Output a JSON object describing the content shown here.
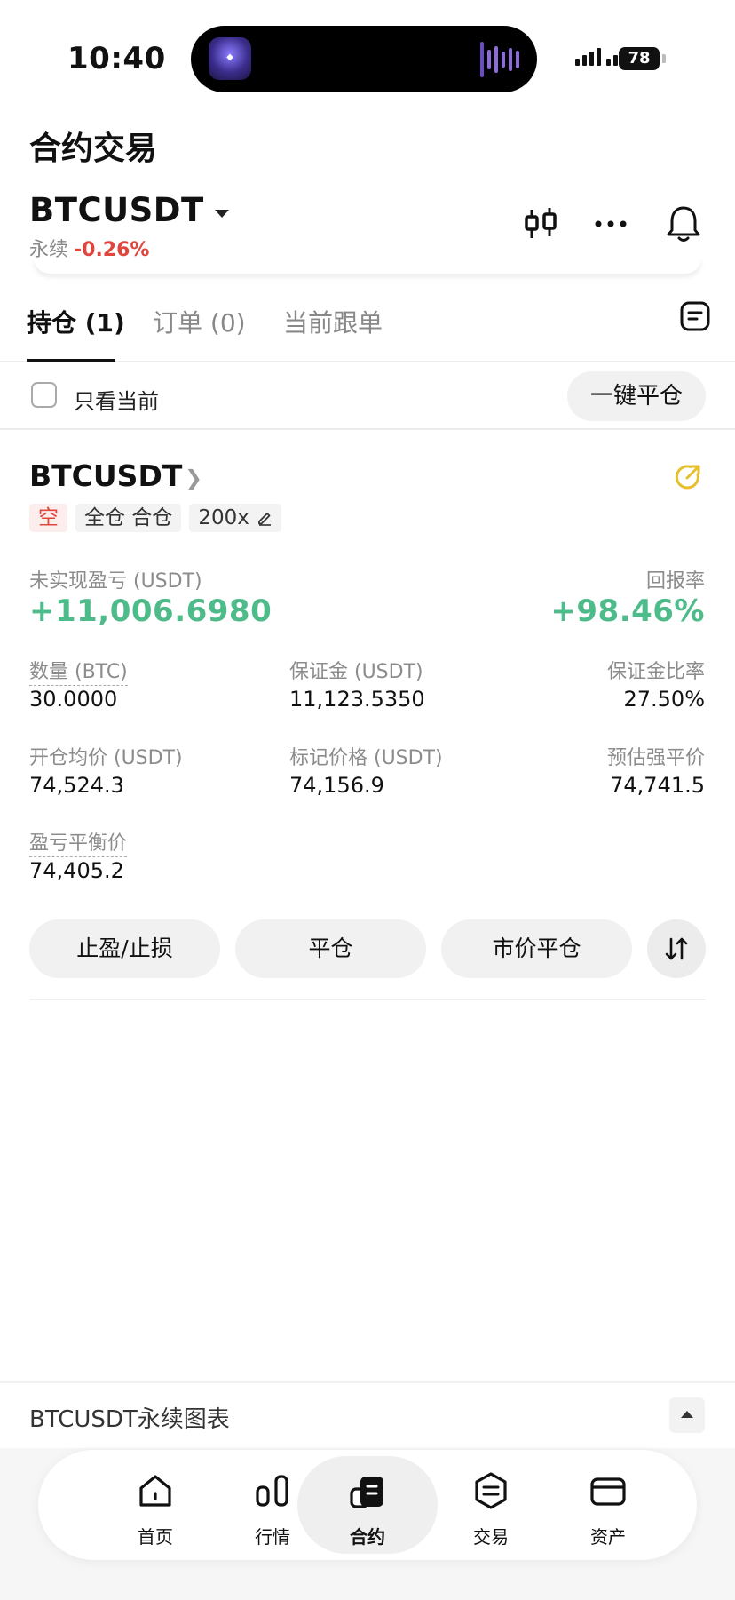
{
  "status": {
    "time": "10:40",
    "battery": "78"
  },
  "page": {
    "title": "合约交易"
  },
  "symbol": {
    "name": "BTCUSDT",
    "type": "永续",
    "change": "-0.26%"
  },
  "tabs": [
    {
      "label": "持仓 (1)"
    },
    {
      "label": "订单 (0)"
    },
    {
      "label": "当前跟单"
    }
  ],
  "filter": {
    "label": "只看当前",
    "close_all": "一键平仓"
  },
  "position": {
    "symbol": "BTCUSDT",
    "side": "空",
    "margin_mode": "全仓 合仓",
    "leverage": "200x",
    "pnl_label": "未实现盈亏 (USDT)",
    "pnl_value": "+11,006.6980",
    "roe_label": "回报率",
    "roe_value": "+98.46%",
    "qty_label": "数量 (BTC)",
    "qty_value": "30.0000",
    "margin_label": "保证金 (USDT)",
    "margin_value": "11,123.5350",
    "margin_ratio_label": "保证金比率",
    "margin_ratio_value": "27.50%",
    "entry_label": "开仓均价 (USDT)",
    "entry_value": "74,524.3",
    "mark_label": "标记价格 (USDT)",
    "mark_value": "74,156.9",
    "liq_label": "预估强平价",
    "liq_value": "74,741.5",
    "breakeven_label": "盈亏平衡价",
    "breakeven_value": "74,405.2"
  },
  "actions": {
    "tpsl": "止盈/止损",
    "close": "平仓",
    "market_close": "市价平仓"
  },
  "chart_bar": {
    "label": "BTCUSDT永续图表"
  },
  "nav": [
    {
      "label": "首页",
      "icon": "home-icon"
    },
    {
      "label": "行情",
      "icon": "market-icon"
    },
    {
      "label": "合约",
      "icon": "futures-icon"
    },
    {
      "label": "交易",
      "icon": "trade-icon"
    },
    {
      "label": "资产",
      "icon": "wallet-icon"
    }
  ],
  "colors": {
    "up": "#4dbb8a",
    "down": "#e0463e",
    "accent_share": "#e5bf2e"
  }
}
